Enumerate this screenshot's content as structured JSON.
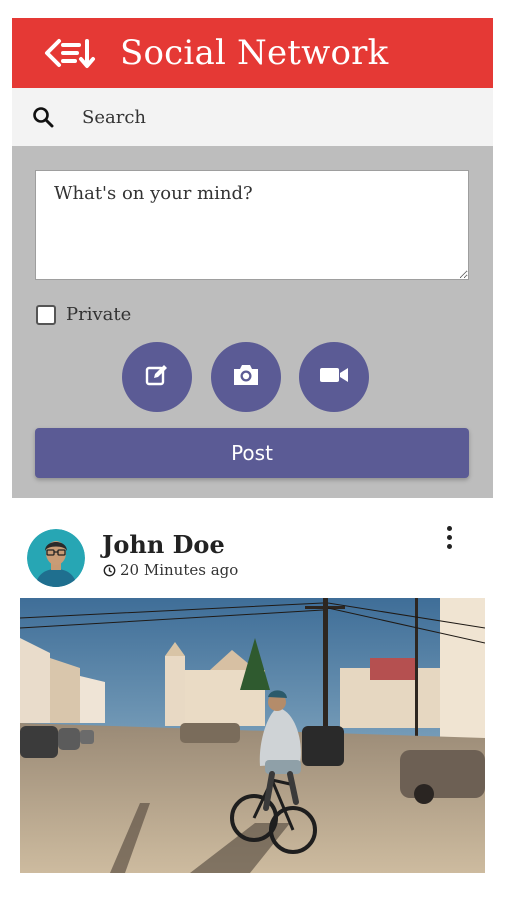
{
  "header": {
    "title": "Social Network",
    "menu_icon": "list-arrow-down-icon",
    "color": "#e53935"
  },
  "search": {
    "placeholder": "Search",
    "icon": "search-icon"
  },
  "composer": {
    "placeholder": "What's on your mind?",
    "private_label": "Private",
    "actions": [
      {
        "icon": "edit-icon"
      },
      {
        "icon": "camera-icon"
      },
      {
        "icon": "video-icon"
      }
    ],
    "post_label": "Post",
    "accent": "#5b5b95"
  },
  "post": {
    "author": "John Doe",
    "timestamp": "20 Minutes ago",
    "image": "street-cyclist-photo"
  }
}
